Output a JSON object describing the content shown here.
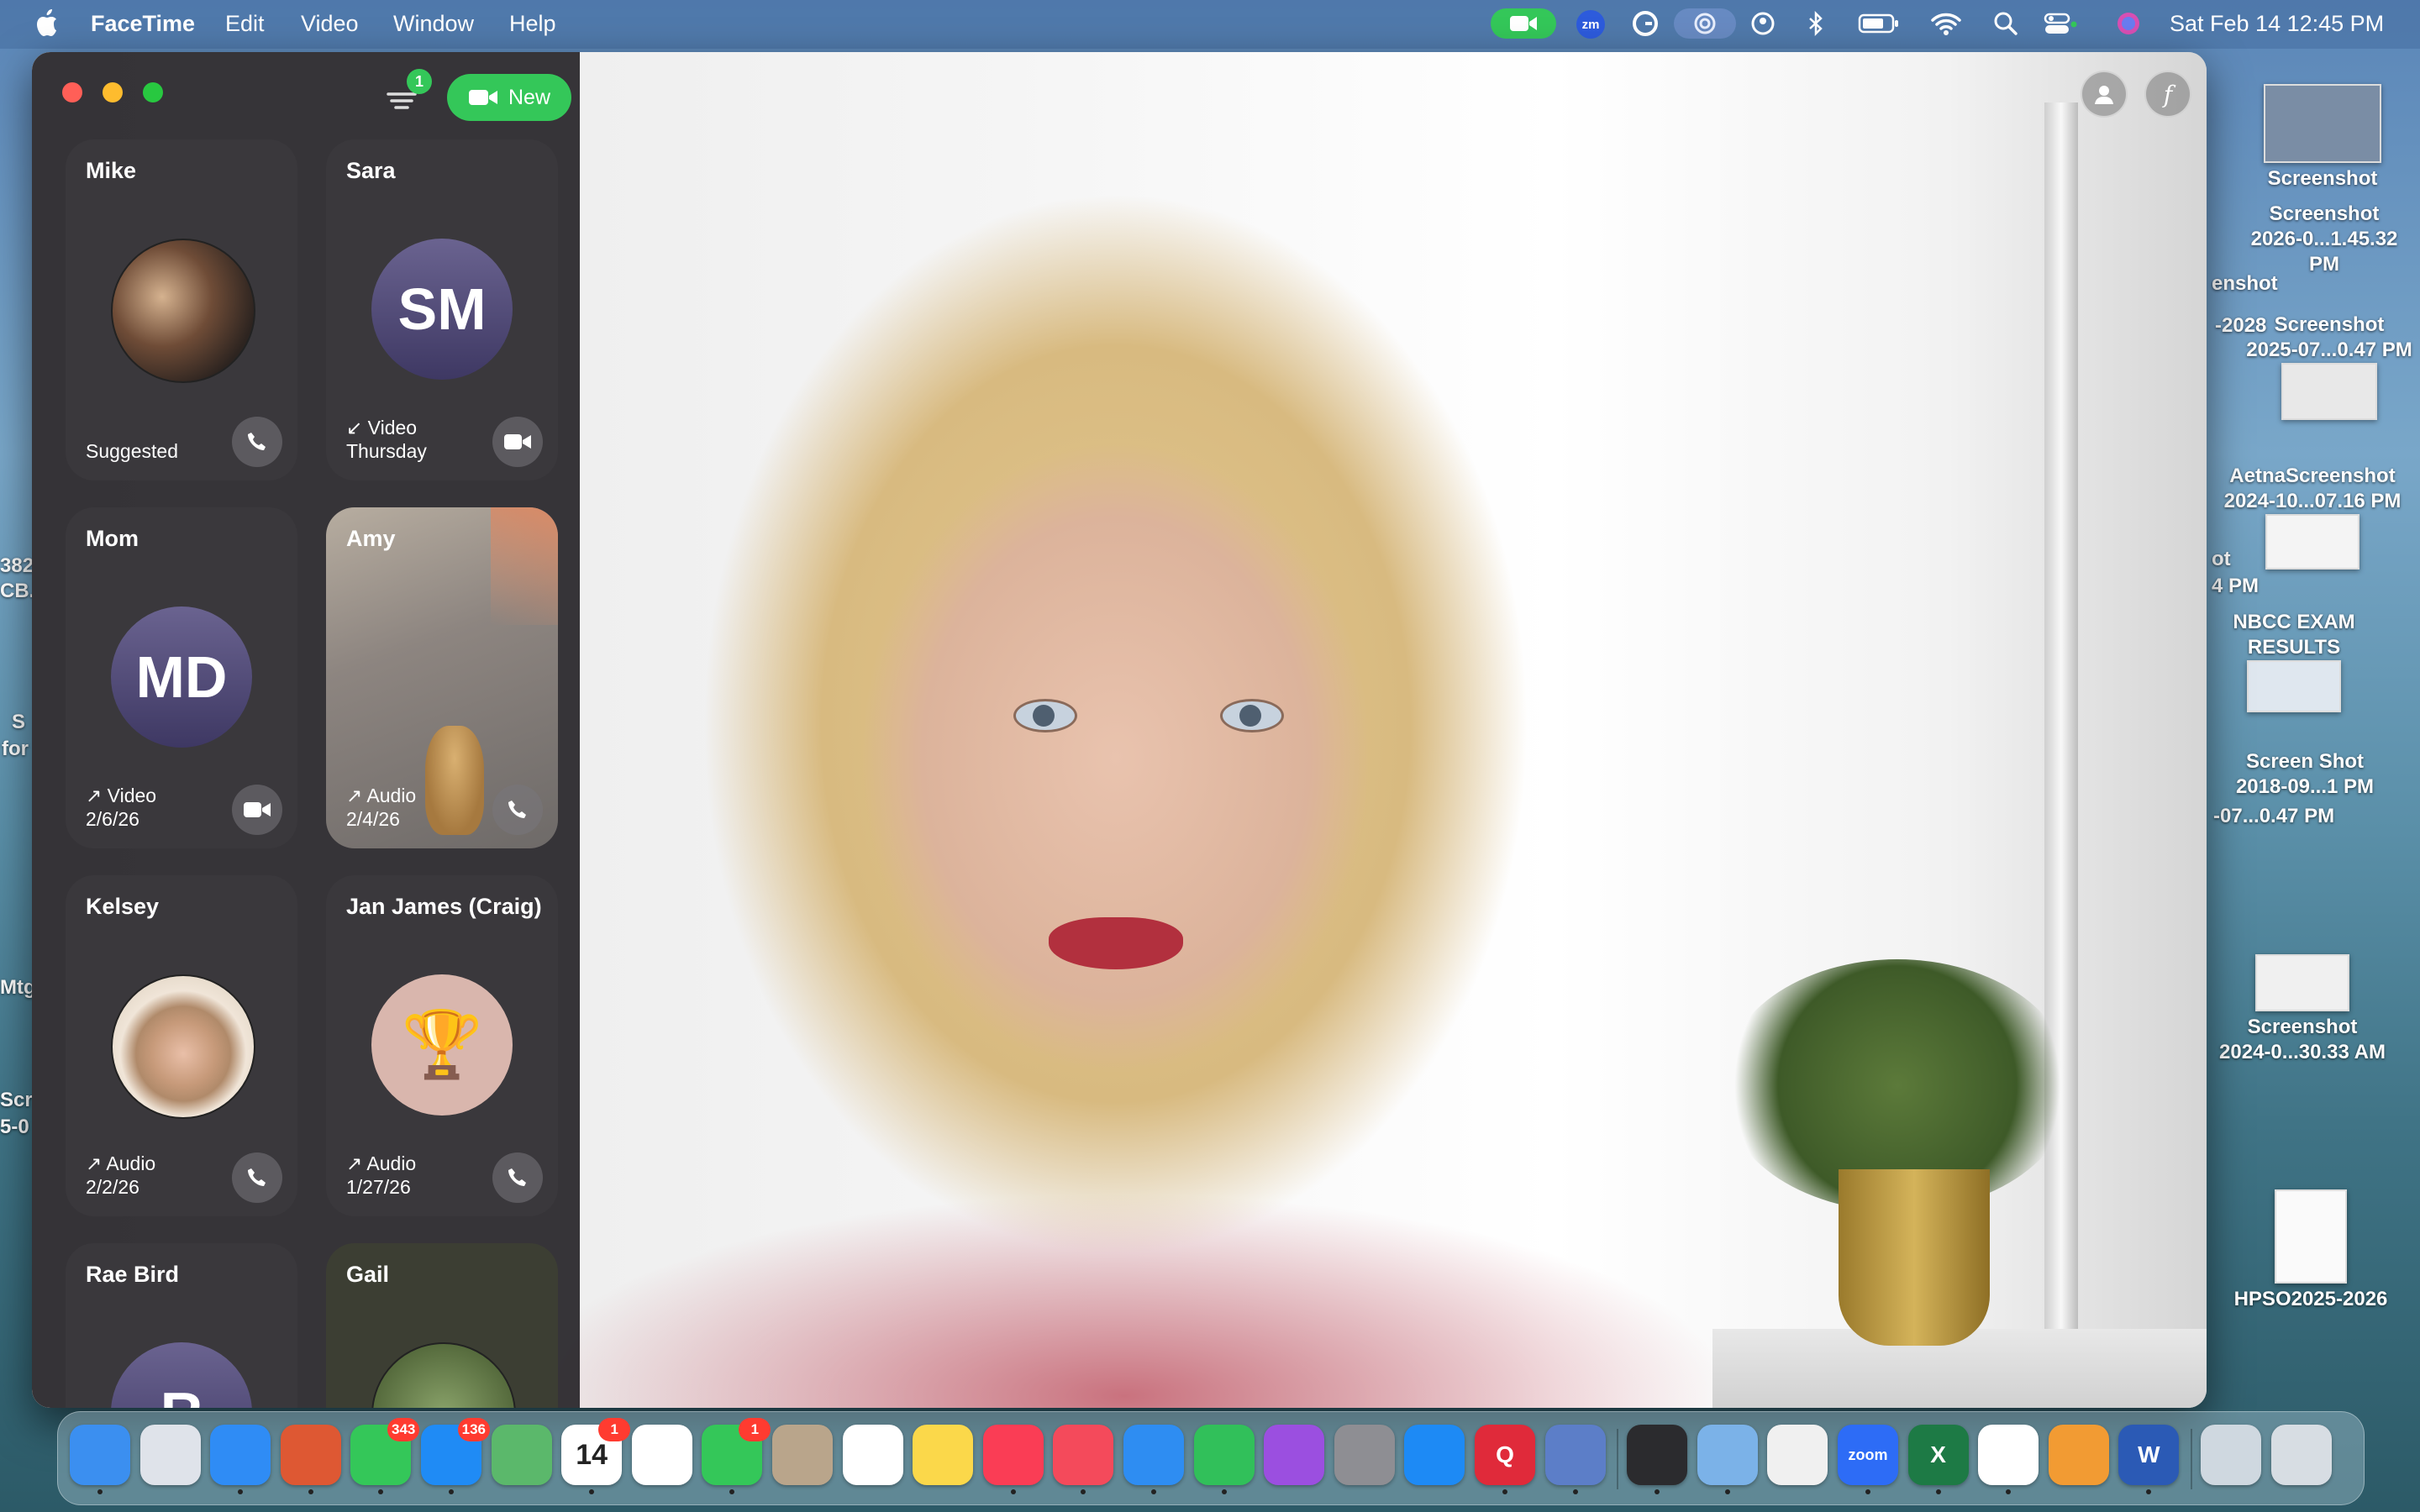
{
  "menubar": {
    "app_name": "FaceTime",
    "items": [
      "Edit",
      "Video",
      "Window",
      "Help"
    ],
    "clock": "Sat Feb 14  12:45 PM",
    "zoom_label": "zm"
  },
  "desktop": {
    "items": [
      {
        "label_1": "Screenshot",
        "label_2": ""
      },
      {
        "label_1": "Screenshot",
        "label_2": "2026-0...1.45.32 PM"
      },
      {
        "label_1": "Screenshot",
        "label_2": "2025-07...0.47 PM"
      },
      {
        "label_1": "AetnaScreenshot",
        "label_2": "2024-10...07.16 PM"
      },
      {
        "label_1": "NBCC EXAM",
        "label_2": "RESULTS"
      },
      {
        "label_1": "Screen Shot",
        "label_2": "2018-09...1 PM"
      },
      {
        "label_1": "Screenshot",
        "label_2": "2024-0...30.33 AM"
      },
      {
        "label_1": "HPSO2025-2026",
        "label_2": ""
      }
    ],
    "edge_fragments": [
      "enshot",
      "-2028",
      "ot",
      "4 PM",
      "-07...0.47 PM",
      "382",
      "CB.",
      "S",
      "for",
      "Scr",
      "5-0",
      "Mtg"
    ]
  },
  "sidebar": {
    "new_label": "New",
    "filter_badge": "1",
    "contacts": [
      {
        "name": "Mike",
        "line1": "Suggested",
        "line2": "",
        "avatar_text": "",
        "action": "phone-icon"
      },
      {
        "name": "Sara",
        "line1": "↙ Video",
        "line2": "Thursday",
        "avatar_text": "SM",
        "action": "video-icon"
      },
      {
        "name": "Mom",
        "line1": "↗ Video",
        "line2": "2/6/26",
        "avatar_text": "MD",
        "action": "video-icon"
      },
      {
        "name": "Amy",
        "line1": "↗ Audio",
        "line2": "2/4/26",
        "avatar_text": "",
        "action": "phone-icon"
      },
      {
        "name": "Kelsey",
        "line1": "↗ Audio",
        "line2": "2/2/26",
        "avatar_text": "",
        "action": "phone-icon"
      },
      {
        "name": "Jan James (Craig)",
        "line1": "↗ Audio",
        "line2": "1/27/26",
        "avatar_text": "🏆",
        "action": "phone-icon"
      },
      {
        "name": "Rae Bird",
        "line1": "",
        "line2": "",
        "avatar_text": "R",
        "action": ""
      },
      {
        "name": "Gail",
        "line1": "",
        "line2": "",
        "avatar_text": "",
        "action": ""
      }
    ]
  },
  "video": {
    "controls": [
      "person-icon",
      "effects-icon"
    ],
    "effects_glyph": "f"
  },
  "dock": {
    "apps": [
      {
        "name": "Finder",
        "label": "",
        "color": "#3b8ff0",
        "badge": ""
      },
      {
        "name": "Launchpad",
        "label": "",
        "color": "#dfe3ea",
        "badge": ""
      },
      {
        "name": "Safari",
        "label": "",
        "color": "#2f8cf5",
        "badge": ""
      },
      {
        "name": "DuckDuckGo",
        "label": "",
        "color": "#de5833",
        "badge": ""
      },
      {
        "name": "Messages",
        "label": "",
        "color": "#34c759",
        "badge": "343"
      },
      {
        "name": "Mail",
        "label": "",
        "color": "#1f8bf5",
        "badge": "136"
      },
      {
        "name": "Maps",
        "label": "",
        "color": "#5bb86b",
        "badge": ""
      },
      {
        "name": "Calendar",
        "label": "14",
        "color": "#ffffff",
        "badge": "1"
      },
      {
        "name": "Photos",
        "label": "",
        "color": "#ffffff",
        "badge": ""
      },
      {
        "name": "FaceTime",
        "label": "",
        "color": "#34c759",
        "badge": "1"
      },
      {
        "name": "Contacts",
        "label": "",
        "color": "#b9a58b",
        "badge": ""
      },
      {
        "name": "Reminders",
        "label": "",
        "color": "#ffffff",
        "badge": ""
      },
      {
        "name": "Notes",
        "label": "",
        "color": "#fbd84a",
        "badge": ""
      },
      {
        "name": "Music",
        "label": "",
        "color": "#fa3d55",
        "badge": ""
      },
      {
        "name": "News",
        "label": "",
        "color": "#f44a5b",
        "badge": ""
      },
      {
        "name": "Keynote",
        "label": "",
        "color": "#2e8df2",
        "badge": ""
      },
      {
        "name": "Numbers",
        "label": "",
        "color": "#31c05a",
        "badge": ""
      },
      {
        "name": "Podcasts",
        "label": "",
        "color": "#9b4fe0",
        "badge": ""
      },
      {
        "name": "System Settings",
        "label": "",
        "color": "#8e8e93",
        "badge": ""
      },
      {
        "name": "App Store",
        "label": "",
        "color": "#1d8af5",
        "badge": ""
      },
      {
        "name": "Quicken",
        "label": "Q",
        "color": "#e02a3a",
        "badge": ""
      },
      {
        "name": "iPhone Mirroring",
        "label": "",
        "color": "#5c7ec8",
        "badge": ""
      },
      {
        "name": "Passwords",
        "label": "",
        "color": "#2b2b2e",
        "badge": ""
      },
      {
        "name": "Preview",
        "label": "",
        "color": "#7bb2e8",
        "badge": ""
      },
      {
        "name": "Table",
        "label": "",
        "color": "#f0f0f0",
        "badge": ""
      },
      {
        "name": "Zoom",
        "label": "zoom",
        "color": "#2d6cf6",
        "badge": ""
      },
      {
        "name": "Excel",
        "label": "X",
        "color": "#1d7a45",
        "badge": ""
      },
      {
        "name": "Chrome",
        "label": "",
        "color": "#ffffff",
        "badge": ""
      },
      {
        "name": "Pages",
        "label": "",
        "color": "#f29b33",
        "badge": ""
      },
      {
        "name": "Word",
        "label": "W",
        "color": "#2b5ab5",
        "badge": ""
      },
      {
        "name": "Downloads",
        "label": "",
        "color": "#cfd8e0",
        "badge": ""
      },
      {
        "name": "Trash",
        "label": "",
        "color": "#d7dde3",
        "badge": ""
      }
    ]
  }
}
